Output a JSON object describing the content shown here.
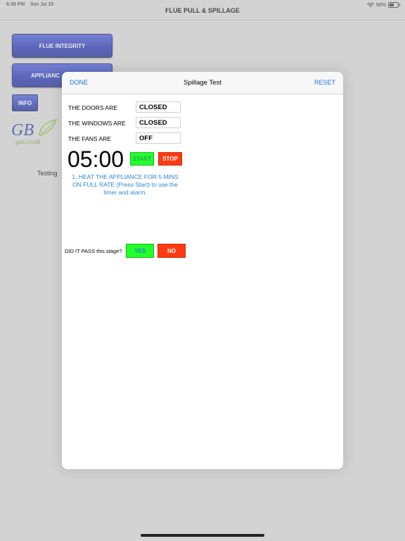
{
  "status": {
    "time": "6:39 PM",
    "date": "Sun Jul 19",
    "battery": "50%",
    "battery_level": 0.5
  },
  "nav": {
    "title": "FLUE PULL & SPILLAGE"
  },
  "background": {
    "flue_integrity_label": "FLUE INTEGRITY",
    "appliance_label": "APPLIANC",
    "info_label": "INFO",
    "logo_text": "GB",
    "logo_sub": "-gas.co.uk",
    "testing_text": "Testing"
  },
  "modal": {
    "done_label": "DONE",
    "title": "Spillage Test",
    "reset_label": "RESET",
    "rows": [
      {
        "label": "THE DOORS ARE",
        "value": "CLOSED"
      },
      {
        "label": "THE WINDOWS ARE",
        "value": "CLOSED"
      },
      {
        "label": "THE FANS ARE",
        "value": "OFF"
      }
    ],
    "timer": "05:00",
    "start_label": "START",
    "stop_label": "STOP",
    "instruction": "1. HEAT THE APPLIANCE FOR 5 MINS ON FULL RATE (Press Start) to use the timer and alarm.",
    "pass_question": "DID IT PASS this stage?",
    "yes_label": "YES",
    "no_label": "NO"
  },
  "colors": {
    "accent": "#1a73d9",
    "green": "#22ff2a",
    "red": "#ff3a12",
    "button_blue": "#2233b5"
  }
}
